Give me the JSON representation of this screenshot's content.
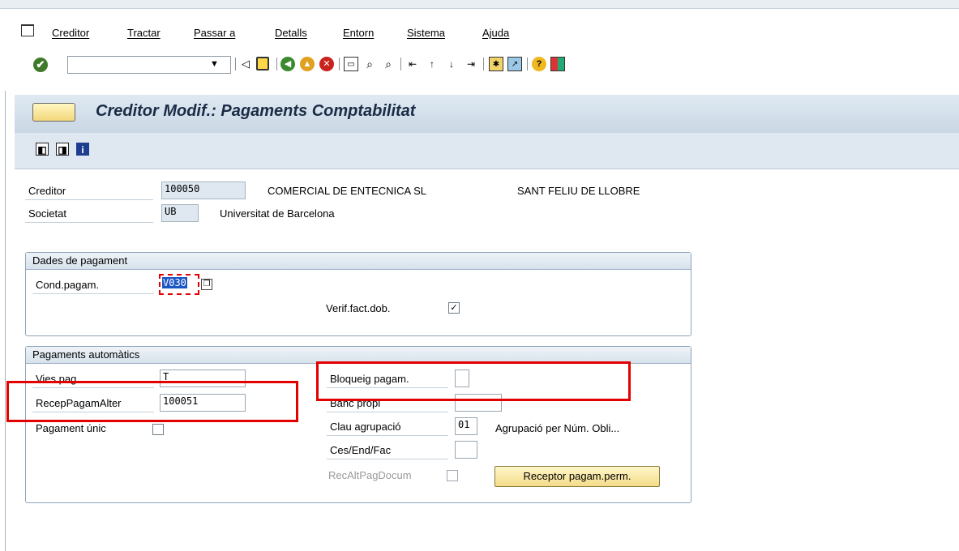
{
  "menu": {
    "items": [
      "Creditor",
      "Tractar",
      "Passar a",
      "Detalls",
      "Entorn",
      "Sistema",
      "Ajuda"
    ]
  },
  "toolbar": {
    "command_value": "",
    "icons": [
      "enter-icon",
      "back-icon",
      "save-icon",
      "back-green-icon",
      "exit-icon",
      "cancel-icon",
      "print-icon",
      "find-icon",
      "find-next-icon",
      "first-page-icon",
      "prev-page-icon",
      "next-page-icon",
      "last-page-icon",
      "new-session-icon",
      "shortcut-icon",
      "help-icon",
      "layout-icon"
    ]
  },
  "title": {
    "text": "Creditor Modif.: Pagaments Comptabilitat"
  },
  "header": {
    "creditor_label": "Creditor",
    "creditor_value": "100050",
    "creditor_name": "COMERCIAL DE ENTECNICA SL",
    "creditor_city": "SANT FELIU DE LLOBRE",
    "societat_label": "Societat",
    "societat_value": "UB",
    "societat_name": "Universitat de Barcelona"
  },
  "dades_pagament": {
    "title": "Dades de pagament",
    "cond_label": "Cond.pagam.",
    "cond_value": "V030",
    "verif_label": "Verif.fact.dob.",
    "verif_checked": true
  },
  "pagaments_automatics": {
    "title": "Pagaments automàtics",
    "vies_label": "Vies pag.",
    "vies_value": "T",
    "recep_label": "RecepPagamAlter",
    "recep_value": "100051",
    "unic_label": "Pagament únic",
    "bloqueig_label": "Bloqueig pagam.",
    "bloqueig_value": "",
    "banc_label": "Banc propi",
    "banc_value": "",
    "clau_label": "Clau agrupació",
    "clau_value": "01",
    "clau_desc": "Agrupació per Núm. Obli...",
    "ces_label": "Ces/End/Fac",
    "ces_value": "",
    "recalt_label": "RecAltPagDocum",
    "receptor_button": "Receptor pagam.perm."
  },
  "colors": {
    "highlight_red": "#e30000",
    "selection_blue": "#1c56c4",
    "button_yellow": "#f4dc8a"
  }
}
